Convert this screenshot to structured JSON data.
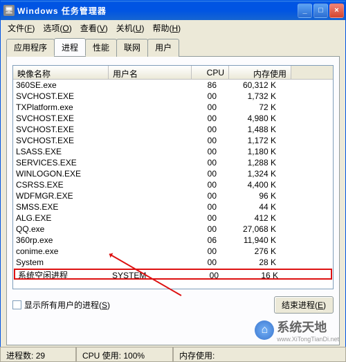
{
  "titlebar": {
    "icon_glyph": "🖥",
    "title": "Windows 任务管理器"
  },
  "menu": {
    "file": {
      "label": "文件",
      "key": "F"
    },
    "options": {
      "label": "选项",
      "key": "O"
    },
    "view": {
      "label": "查看",
      "key": "V"
    },
    "shutdown": {
      "label": "关机",
      "key": "U"
    },
    "help": {
      "label": "帮助",
      "key": "H"
    }
  },
  "tabs": {
    "apps": "应用程序",
    "processes": "进程",
    "performance": "性能",
    "network": "联网",
    "users": "用户"
  },
  "columns": {
    "image": "映像名称",
    "user": "用户名",
    "cpu": "CPU",
    "mem": "内存使用"
  },
  "processes": [
    {
      "name": "360SE.exe",
      "user": "",
      "cpu": "86",
      "mem": "60,312 K"
    },
    {
      "name": "SVCHOST.EXE",
      "user": "",
      "cpu": "00",
      "mem": "1,732 K"
    },
    {
      "name": "TXPlatform.exe",
      "user": "",
      "cpu": "00",
      "mem": "72 K"
    },
    {
      "name": "SVCHOST.EXE",
      "user": "",
      "cpu": "00",
      "mem": "4,980 K"
    },
    {
      "name": "SVCHOST.EXE",
      "user": "",
      "cpu": "00",
      "mem": "1,488 K"
    },
    {
      "name": "SVCHOST.EXE",
      "user": "",
      "cpu": "00",
      "mem": "1,172 K"
    },
    {
      "name": "LSASS.EXE",
      "user": "",
      "cpu": "00",
      "mem": "1,180 K"
    },
    {
      "name": "SERVICES.EXE",
      "user": "",
      "cpu": "00",
      "mem": "1,288 K"
    },
    {
      "name": "WINLOGON.EXE",
      "user": "",
      "cpu": "00",
      "mem": "1,324 K"
    },
    {
      "name": "CSRSS.EXE",
      "user": "",
      "cpu": "00",
      "mem": "4,400 K"
    },
    {
      "name": "WDFMGR.EXE",
      "user": "",
      "cpu": "00",
      "mem": "96 K"
    },
    {
      "name": "SMSS.EXE",
      "user": "",
      "cpu": "00",
      "mem": "44 K"
    },
    {
      "name": "ALG.EXE",
      "user": "",
      "cpu": "00",
      "mem": "412 K"
    },
    {
      "name": "QQ.exe",
      "user": "",
      "cpu": "00",
      "mem": "27,068 K"
    },
    {
      "name": "360rp.exe",
      "user": "",
      "cpu": "06",
      "mem": "11,940 K"
    },
    {
      "name": "conime.exe",
      "user": "",
      "cpu": "00",
      "mem": "276 K"
    },
    {
      "name": "System",
      "user": "",
      "cpu": "00",
      "mem": "28 K"
    },
    {
      "name": "系统空闲进程",
      "user": "SYSTEM",
      "cpu": "00",
      "mem": "16 K",
      "highlight": true
    }
  ],
  "controls": {
    "show_all_users": "显示所有用户的进程",
    "show_all_users_key": "S",
    "end_process": "结束进程",
    "end_process_key": "E"
  },
  "status": {
    "process_count_label": "进程数:",
    "process_count": "29",
    "cpu_label": "CPU 使用:",
    "cpu_value": "100%",
    "mem_label": "内存使用:"
  },
  "watermark": {
    "brand": "系统天地",
    "url": "www.XiTongTianDi.net",
    "icon": "⌂"
  }
}
